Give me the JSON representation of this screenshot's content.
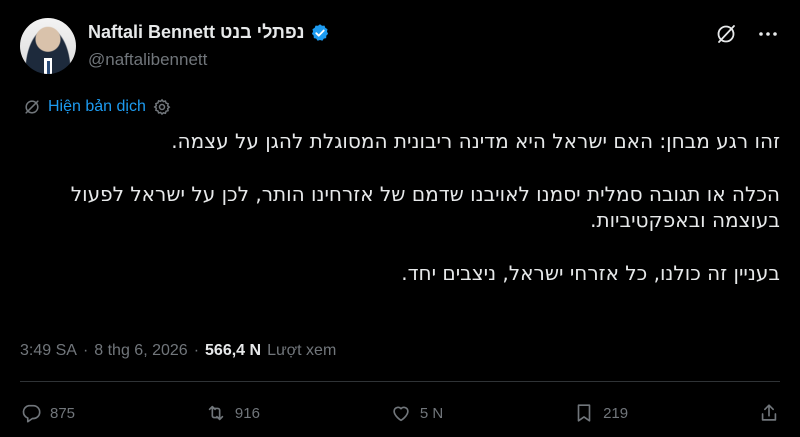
{
  "author": {
    "display_name": "Naftali Bennett נפתלי בנט",
    "handle": "@naftalibennett"
  },
  "translate_label": "Hiện bản dịch",
  "post": {
    "paragraphs": [
      "זהו רגע מבחן: האם ישראל היא מדינה ריבונית המסוגלת להגן על עצמה.",
      "הכלה או תגובה סמלית יסמנו לאויבנו שדמם של אזרחינו הותר, לכן על ישראל לפעול בעוצמה ובאפקטיביות.",
      "בעניין זה כולנו, כל אזרחי ישראל, ניצבים יחד."
    ]
  },
  "meta": {
    "time": "3:49 SA",
    "date": "8 thg 6, 2026",
    "views": "566,4 N",
    "views_label": "Lượt xem"
  },
  "stats": {
    "replies": "875",
    "reposts": "916",
    "likes": "5 N",
    "bookmarks": "219"
  },
  "colors": {
    "background": "#000000",
    "text": "#e7e9ea",
    "muted": "#71767b",
    "accent": "#1d9bf0",
    "divider": "#2f3336"
  }
}
